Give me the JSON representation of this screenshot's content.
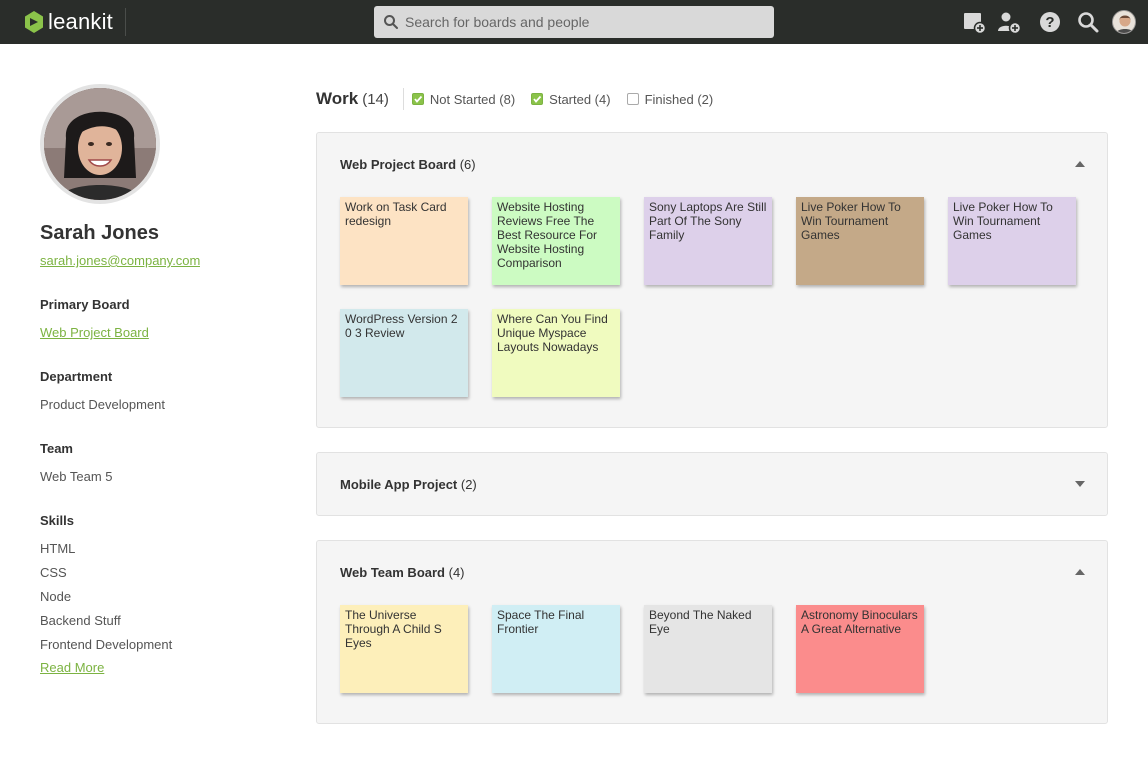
{
  "app": {
    "logo_text": "leankit"
  },
  "search": {
    "placeholder": "Search for boards and people",
    "value": ""
  },
  "topbar_icons": [
    "add-board-icon",
    "add-user-icon",
    "help-icon",
    "search-icon",
    "user-avatar"
  ],
  "profile": {
    "name": "Sarah Jones",
    "email": "sarah.jones@company.com",
    "primary_board_label": "Primary Board",
    "primary_board": "Web Project Board",
    "department_label": "Department",
    "department": "Product Development",
    "team_label": "Team",
    "team": "Web Team 5",
    "skills_label": "Skills",
    "skills": [
      "HTML",
      "CSS",
      "Node",
      "Backend Stuff",
      "Frontend Development"
    ],
    "read_more": "Read More"
  },
  "work": {
    "title": "Work",
    "count": "(14)",
    "filters": [
      {
        "label": "Not Started (8)",
        "checked": true
      },
      {
        "label": "Started (4)",
        "checked": true
      },
      {
        "label": "Finished (2)",
        "checked": false
      }
    ]
  },
  "boards": [
    {
      "name": "Web Project Board",
      "count": "(6)",
      "expanded": true,
      "cards": [
        {
          "title": "Work on Task Card redesign",
          "color": "#fde3c4"
        },
        {
          "title": "Website Hosting Reviews Free The Best Resource For Website Hosting Comparison",
          "color": "#ccfbc2"
        },
        {
          "title": "Sony Laptops Are Still Part Of The Sony Family",
          "color": "#ddd0ea"
        },
        {
          "title": "Live Poker How To Win Tournament Games",
          "color": "#c4a988"
        },
        {
          "title": "Live Poker How To Win Tournament Games",
          "color": "#ddd0ea"
        },
        {
          "title": "WordPress Version 2 0 3 Review",
          "color": "#d2e9ec"
        },
        {
          "title": "Where Can You Find Unique Myspace Layouts Nowadays",
          "color": "#f0fbbf"
        }
      ]
    },
    {
      "name": "Mobile App Project",
      "count": "(2)",
      "expanded": false,
      "cards": []
    },
    {
      "name": "Web Team Board",
      "count": "(4)",
      "expanded": true,
      "cards": [
        {
          "title": "The Universe Through A Child S Eyes",
          "color": "#fdefba"
        },
        {
          "title": "Space The Final Frontier",
          "color": "#d0eef4"
        },
        {
          "title": "Beyond The Naked Eye",
          "color": "#e5e5e5"
        },
        {
          "title": "Astronomy Binoculars A Great Alternative",
          "color": "#fb8c8c"
        }
      ]
    }
  ],
  "colors": {
    "topbar": "#2a2d2a",
    "accent_green": "#7cb342"
  }
}
